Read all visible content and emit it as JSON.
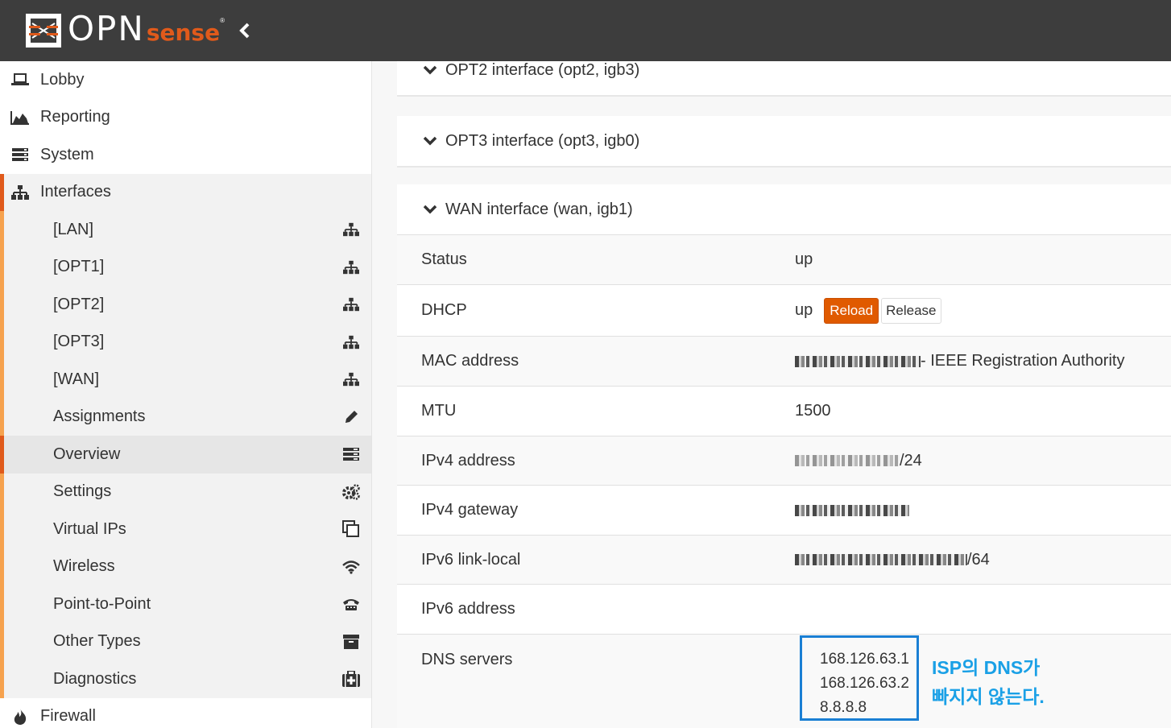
{
  "app": {
    "brand_main": "OPN",
    "brand_accent": "sense",
    "brand_reg": "®"
  },
  "colors": {
    "topbar": "#3d3d3d",
    "accent": "#e05a1b",
    "submenu_bar": "#f6a24e",
    "annotation": "#1aa0e6",
    "highlight_box": "#1a7fd4"
  },
  "sidebar": {
    "top_items": [
      {
        "label": "Lobby",
        "icon": "laptop-icon"
      },
      {
        "label": "Reporting",
        "icon": "area-chart-icon"
      },
      {
        "label": "System",
        "icon": "server-icon"
      }
    ],
    "group": {
      "label": "Interfaces",
      "icon": "sitemap-icon",
      "items": [
        {
          "label": "[LAN]",
          "icon": "sitemap-icon"
        },
        {
          "label": "[OPT1]",
          "icon": "sitemap-icon"
        },
        {
          "label": "[OPT2]",
          "icon": "sitemap-icon"
        },
        {
          "label": "[OPT3]",
          "icon": "sitemap-icon"
        },
        {
          "label": "[WAN]",
          "icon": "sitemap-icon"
        },
        {
          "label": "Assignments",
          "icon": "pencil-icon"
        },
        {
          "label": "Overview",
          "icon": "list-icon",
          "active": true
        },
        {
          "label": "Settings",
          "icon": "cogs-icon"
        },
        {
          "label": "Virtual IPs",
          "icon": "clone-icon"
        },
        {
          "label": "Wireless",
          "icon": "wifi-icon"
        },
        {
          "label": "Point-to-Point",
          "icon": "phone-icon"
        },
        {
          "label": "Other Types",
          "icon": "archive-icon"
        },
        {
          "label": "Diagnostics",
          "icon": "medkit-icon"
        }
      ]
    },
    "bottom_items": [
      {
        "label": "Firewall",
        "icon": "fire-icon"
      }
    ]
  },
  "main": {
    "panels": [
      {
        "title": "OPT2 interface (opt2, igb3)"
      },
      {
        "title": "OPT3 interface (opt3, igb0)"
      },
      {
        "title": "WAN interface (wan, igb1)"
      }
    ],
    "wan": {
      "status": {
        "label": "Status",
        "value": "up"
      },
      "dhcp": {
        "label": "DHCP",
        "value": "up",
        "reload": "Reload",
        "release": "Release"
      },
      "mac": {
        "label": "MAC address",
        "suffix": "- IEEE Registration Authority"
      },
      "mtu": {
        "label": "MTU",
        "value": "1500"
      },
      "ipv4": {
        "label": "IPv4 address",
        "suffix": "/24"
      },
      "gateway": {
        "label": "IPv4 gateway"
      },
      "ipv6ll": {
        "label": "IPv6 link-local",
        "suffix": "/64"
      },
      "ipv6": {
        "label": "IPv6 address"
      },
      "dns": {
        "label": "DNS servers",
        "servers": [
          "168.126.63.1",
          "168.126.63.2",
          "8.8.8.8"
        ]
      }
    },
    "annotation": {
      "line1": "ISP의 DNS가",
      "line2": "빠지지 않는다."
    }
  }
}
